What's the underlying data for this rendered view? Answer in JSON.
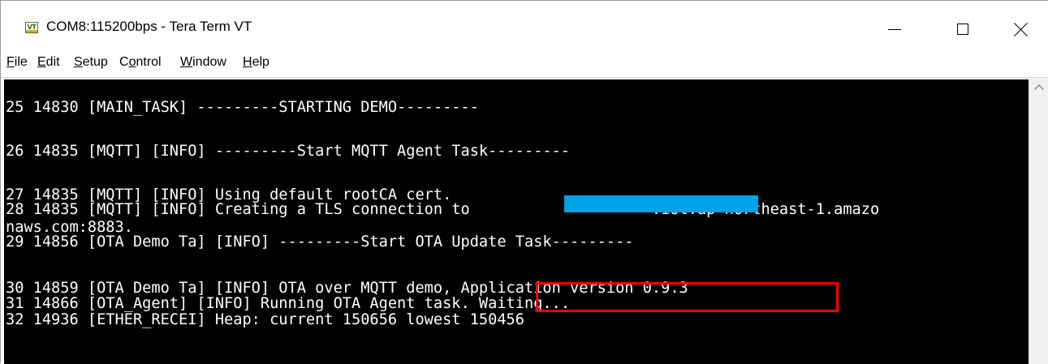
{
  "window": {
    "title": "COM8:115200bps - Tera Term VT",
    "app_icon_text": "VT",
    "controls": {
      "minimize": "minimize-icon",
      "maximize": "maximize-icon",
      "close": "close-icon"
    }
  },
  "menu": {
    "items": [
      {
        "key": "F",
        "rest": "ile"
      },
      {
        "key": "E",
        "rest": "dit"
      },
      {
        "key": "S",
        "rest": "etup"
      },
      {
        "pre": "C",
        "key": "o",
        "rest": "ntrol"
      },
      {
        "key": "W",
        "rest": "indow"
      },
      {
        "key": "H",
        "rest": "elp"
      }
    ]
  },
  "terminal": {
    "lines": [
      "25 14830 [MAIN_TASK] ---------STARTING DEMO---------",
      "26 14835 [MQTT] [INFO] ---------Start MQTT Agent Task---------",
      "27 14835 [MQTT] [INFO] Using default rootCA cert.",
      "28 14835 [MQTT] [INFO] Creating a TLS connection to                    .iot.ap-northeast-1.amazo",
      "naws.com:8883.",
      "29 14856 [OTA Demo Ta] [INFO] ---------Start OTA Update Task---------",
      "30 14859 [OTA Demo Ta] [INFO] OTA over MQTT demo, Application version 0.9.3",
      "31 14866 [OTA_Agent] [INFO] Running OTA Agent task. Waiting...",
      "32 14936 [ETHER_RECEI] Heap: current 150656 lowest 150456"
    ],
    "colors": {
      "background": "#000000",
      "text": "#ffffff",
      "redaction": "#00a2e8",
      "highlight": "#ff0000"
    }
  }
}
